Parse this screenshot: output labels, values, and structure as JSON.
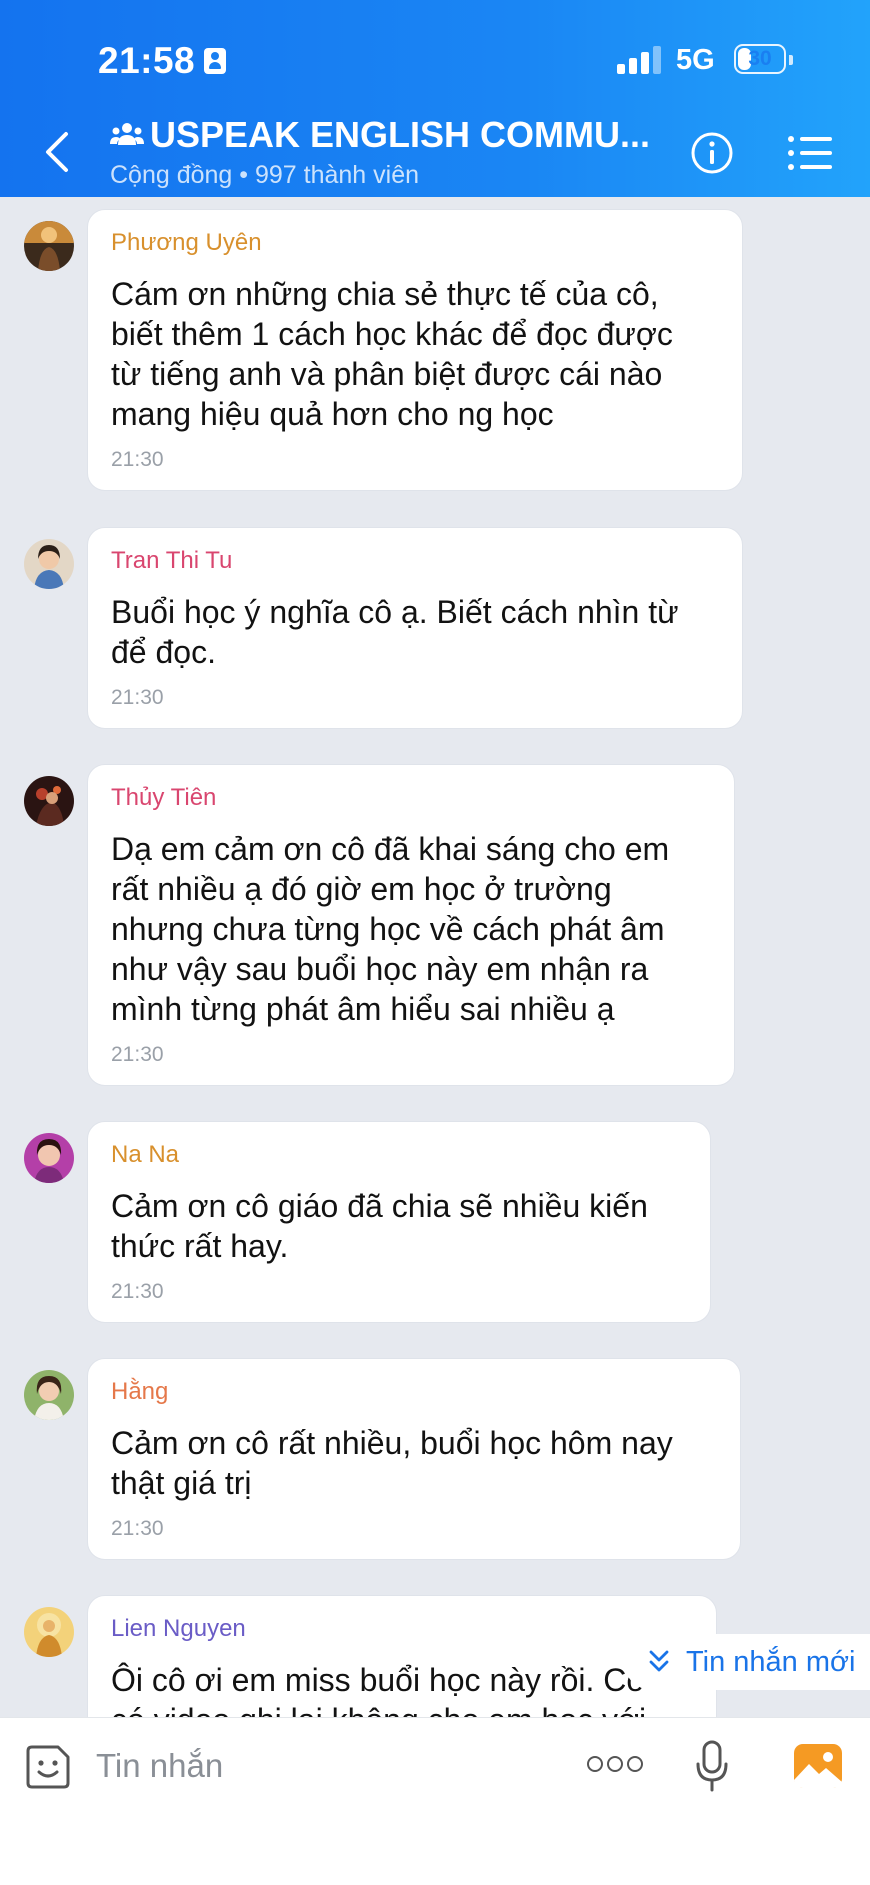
{
  "status_bar": {
    "time": "21:58",
    "network": "5G",
    "battery": "30",
    "battery_level": 0.3
  },
  "header": {
    "title": "USPEAK ENGLISH COMMU...",
    "subtitle": "Cộng đồng • 997 thành viên",
    "icons": [
      "back-arrow-icon",
      "group-icon",
      "info-icon",
      "menu-list-icon"
    ]
  },
  "messages": [
    {
      "sender": "Phương Uyên",
      "sender_color": "#d8902d",
      "lines": [
        "Cám ơn những chia sẻ thực tế của cô,",
        "biết thêm 1 cách học khác để đọc được",
        "từ tiếng anh và phân biệt được cái nào",
        "mang hiệu quả hơn cho ng học"
      ],
      "time": "21:30"
    },
    {
      "sender": "Tran Thi Tu",
      "sender_color": "#d9466f",
      "lines": [
        "Buổi học ý nghĩa cô ạ. Biết cách nhìn từ",
        "để đọc."
      ],
      "time": "21:30"
    },
    {
      "sender": "Thủy Tiên",
      "sender_color": "#d9466f",
      "lines": [
        "Dạ em cảm ơn cô đã khai sáng cho em",
        "rất nhiều ạ đó giờ em học ở trường",
        "nhưng chưa từng học về cách phát âm",
        "như vậy sau buổi học này em nhận ra",
        "mình từng phát âm hiểu sai nhiều ạ"
      ],
      "time": "21:30"
    },
    {
      "sender": "Na Na",
      "sender_color": "#d8902d",
      "lines": [
        "Cảm ơn cô giáo đã chia sẽ nhiều kiến",
        "thức rất hay."
      ],
      "time": "21:30"
    },
    {
      "sender": "Hằng",
      "sender_color": "#e5784a",
      "lines": [
        "Cảm ơn cô rất nhiều, buổi học hôm nay",
        "thật giá trị"
      ],
      "time": "21:30"
    },
    {
      "sender": "Lien Nguyen",
      "sender_color": "#6a5cc6",
      "lines": [
        "Ôi cô ơi em miss buổi học này rồi. Cô",
        "có video ghi lại không cho em học với"
      ],
      "time": ""
    }
  ],
  "new_messages_label": "Tin nhắn mới",
  "composer": {
    "placeholder": "Tin nhắn"
  },
  "colors": {
    "header_start": "#1473ef",
    "header_end": "#22a3fb",
    "background": "#e6e9ef",
    "accent": "#1a74e8",
    "image_button": "#f59a23"
  }
}
